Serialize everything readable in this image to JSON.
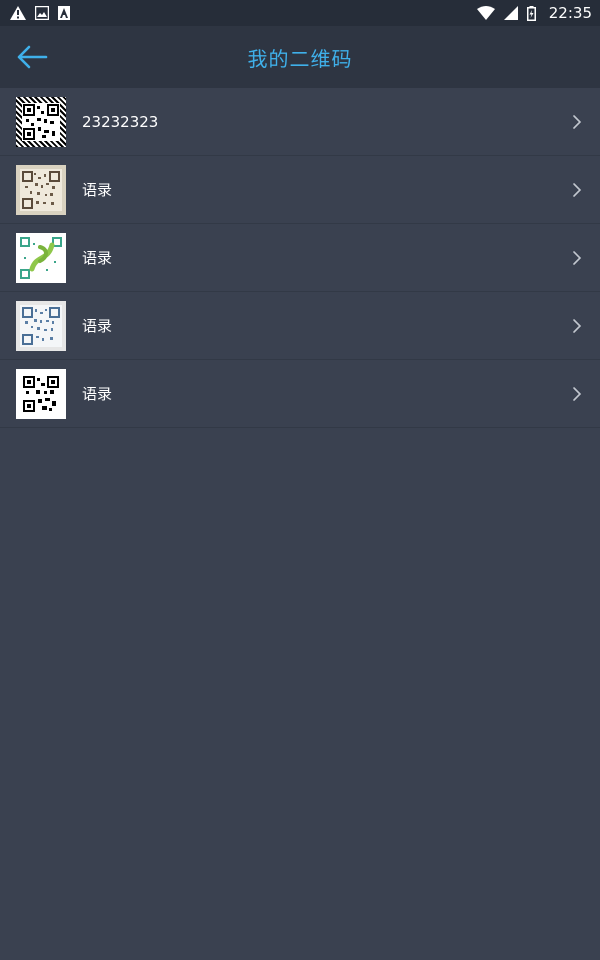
{
  "status_bar": {
    "time": "22:35",
    "left_icons": [
      "warning-icon",
      "image-icon",
      "text-icon"
    ],
    "right_icons": [
      "wifi-icon",
      "signal-icon",
      "battery-icon"
    ]
  },
  "app_bar": {
    "title": "我的二维码",
    "accent": "#3fb0ea"
  },
  "items": [
    {
      "label": "23232323",
      "thumb_style": "zebra"
    },
    {
      "label": "语录",
      "thumb_style": "beige"
    },
    {
      "label": "语录",
      "thumb_style": "green-art"
    },
    {
      "label": "语录",
      "thumb_style": "blue"
    },
    {
      "label": "语录",
      "thumb_style": "plain"
    }
  ],
  "colors": {
    "background": "#3a4150",
    "app_bar": "#2e3542",
    "status_bar": "#262d39"
  }
}
